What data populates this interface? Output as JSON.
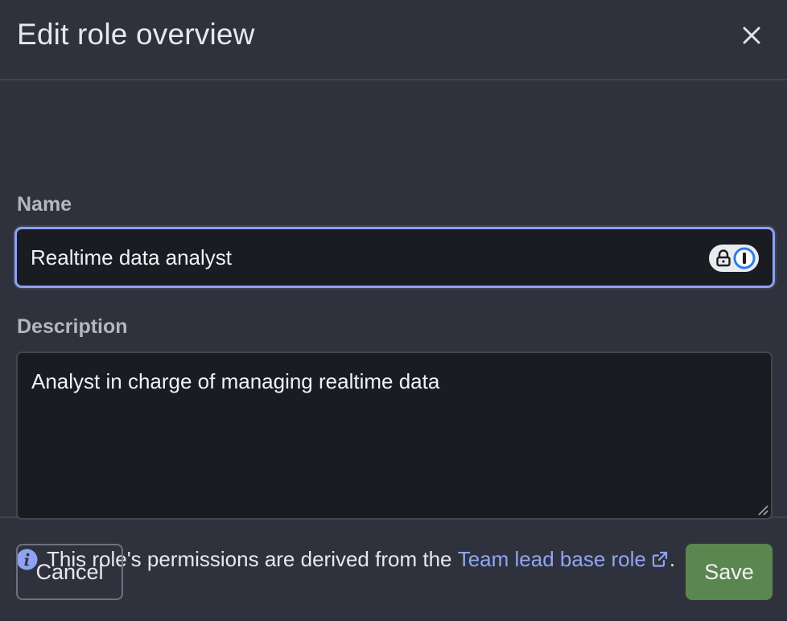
{
  "dialog": {
    "title": "Edit role overview",
    "close_icon": "close-icon"
  },
  "form": {
    "name_label": "Name",
    "name_value": "Realtime data analyst",
    "password_manager_icon": "password-manager-icon",
    "description_label": "Description",
    "description_value": "Analyst in charge of managing realtime data"
  },
  "info": {
    "icon": "info-icon",
    "text_prefix": "This role's permissions are derived from the ",
    "link_text": "Team lead base role",
    "link_icon": "external-link-icon",
    "text_suffix": "."
  },
  "footer": {
    "cancel_label": "Cancel",
    "save_label": "Save"
  },
  "colors": {
    "background": "#2f323c",
    "input_background": "#1b1c21",
    "focus_border": "#8ea2f2",
    "link": "#8fa6f5",
    "save_button": "#5a8650"
  }
}
